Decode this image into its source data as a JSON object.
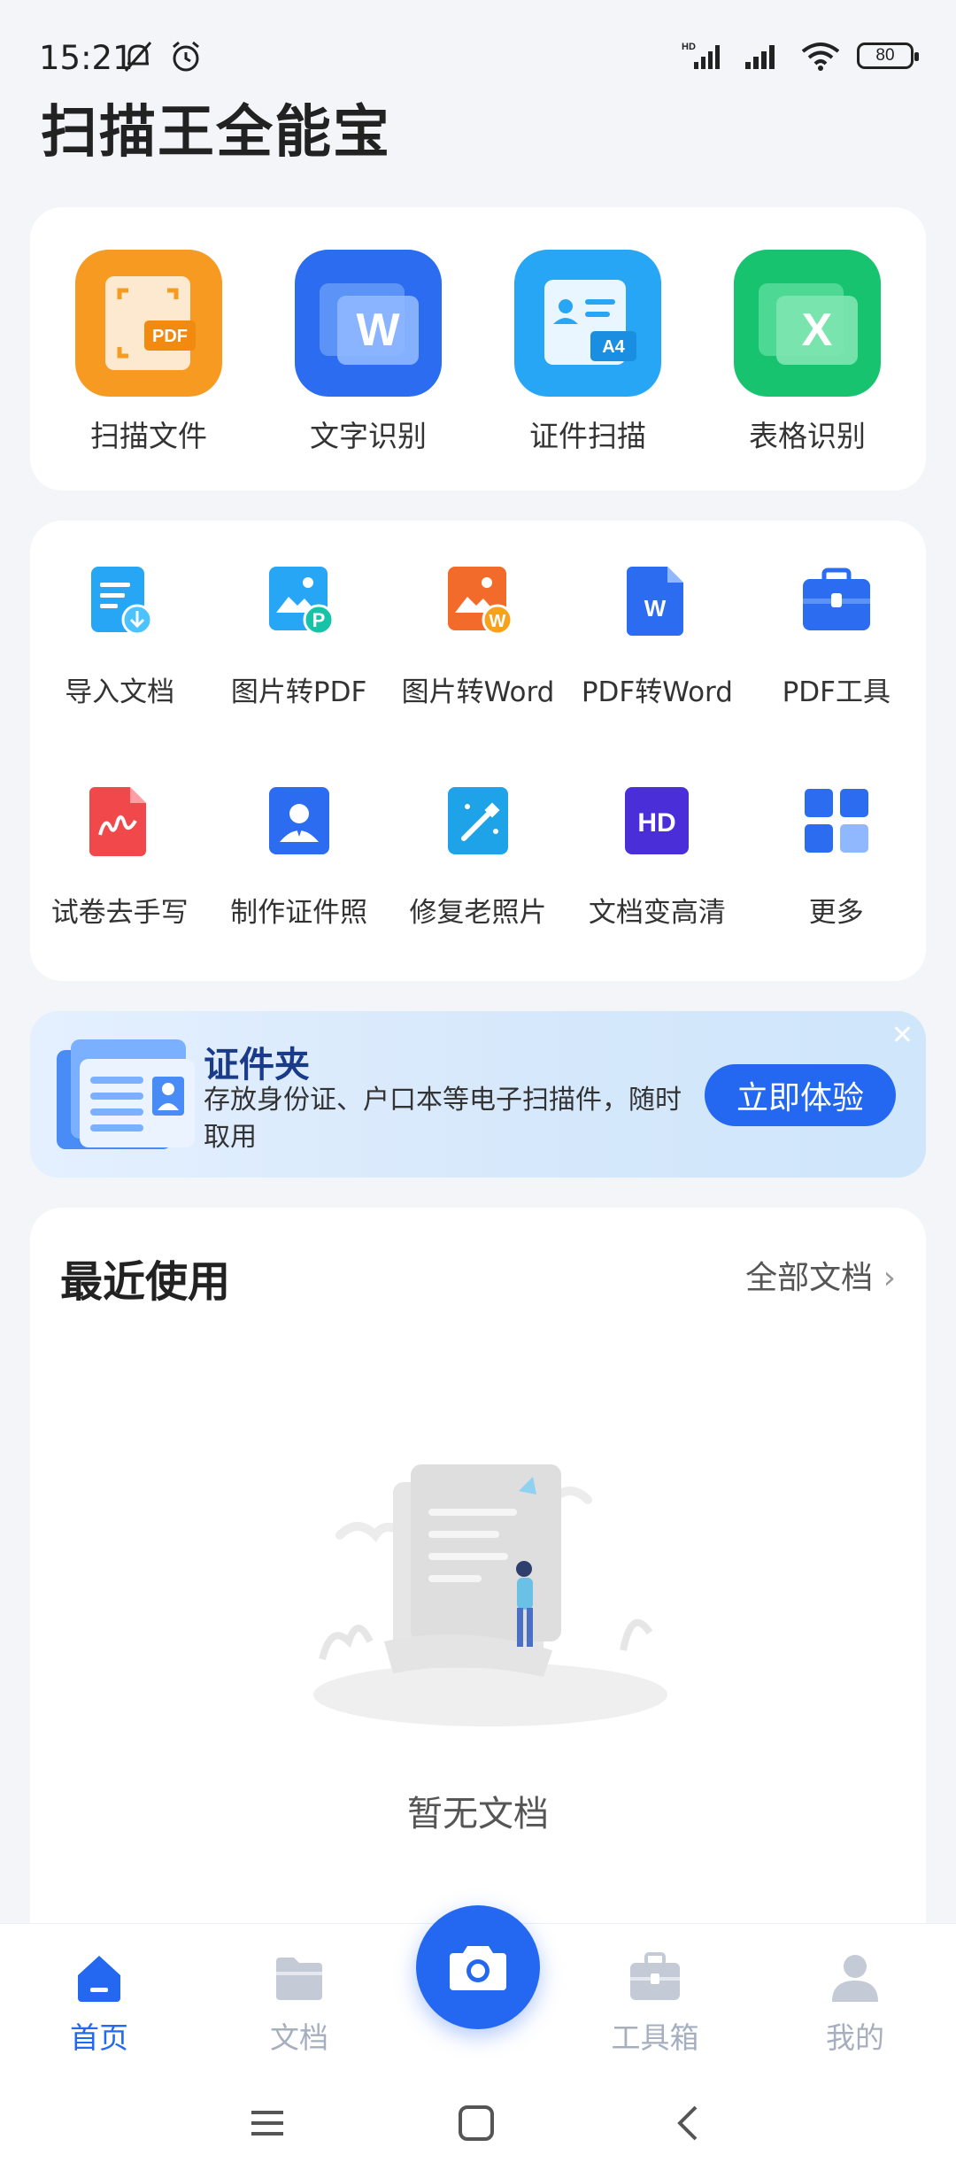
{
  "status_bar": {
    "time": "15:21",
    "icons": [
      "mute-bell-icon",
      "alarm-icon"
    ],
    "right_icons": [
      "hd-signal-icon",
      "signal-icon",
      "wifi-icon"
    ],
    "battery": "80"
  },
  "app": {
    "title": "扫描王全能宝"
  },
  "main_tools": [
    {
      "label": "扫描文件",
      "icon": "scan-pdf-icon",
      "badge": "PDF",
      "color": "#f79a22"
    },
    {
      "label": "文字识别",
      "icon": "word-ocr-icon",
      "badge": "W",
      "color": "#2b6cf0"
    },
    {
      "label": "证件扫描",
      "icon": "id-card-scan-icon",
      "badge": "A4",
      "color": "#27a6f5"
    },
    {
      "label": "表格识别",
      "icon": "excel-ocr-icon",
      "badge": "X",
      "color": "#17c36e"
    }
  ],
  "tools": [
    {
      "label": "导入文档",
      "icon": "import-doc-icon"
    },
    {
      "label": "图片转PDF",
      "icon": "image-to-pdf-icon",
      "badge": "P"
    },
    {
      "label": "图片转Word",
      "icon": "image-to-word-icon",
      "badge": "W"
    },
    {
      "label": "PDF转Word",
      "icon": "pdf-to-word-icon",
      "badge": "W"
    },
    {
      "label": "PDF工具",
      "icon": "toolbox-icon"
    },
    {
      "label": "试卷去手写",
      "icon": "remove-handwriting-icon"
    },
    {
      "label": "制作证件照",
      "icon": "id-photo-icon"
    },
    {
      "label": "修复老照片",
      "icon": "photo-restore-icon"
    },
    {
      "label": "文档变高清",
      "icon": "hd-document-icon",
      "badge": "HD"
    },
    {
      "label": "更多",
      "icon": "more-grid-icon"
    }
  ],
  "banner": {
    "title": "证件夹",
    "description": "存放身份证、户口本等电子扫描件，随时取用",
    "button": "立即体验"
  },
  "recent": {
    "title": "最近使用",
    "all_docs": "全部文档",
    "empty_text": "暂无文档"
  },
  "bottom_nav": [
    {
      "label": "首页",
      "icon": "home-icon",
      "active": true
    },
    {
      "label": "文档",
      "icon": "folder-icon",
      "active": false
    },
    {
      "label": "工具箱",
      "icon": "toolbox-icon",
      "active": false
    },
    {
      "label": "我的",
      "icon": "profile-icon",
      "active": false
    }
  ],
  "colors": {
    "accent": "#2468f2",
    "background": "#f3f5f9",
    "inactive": "#a6afc0"
  }
}
